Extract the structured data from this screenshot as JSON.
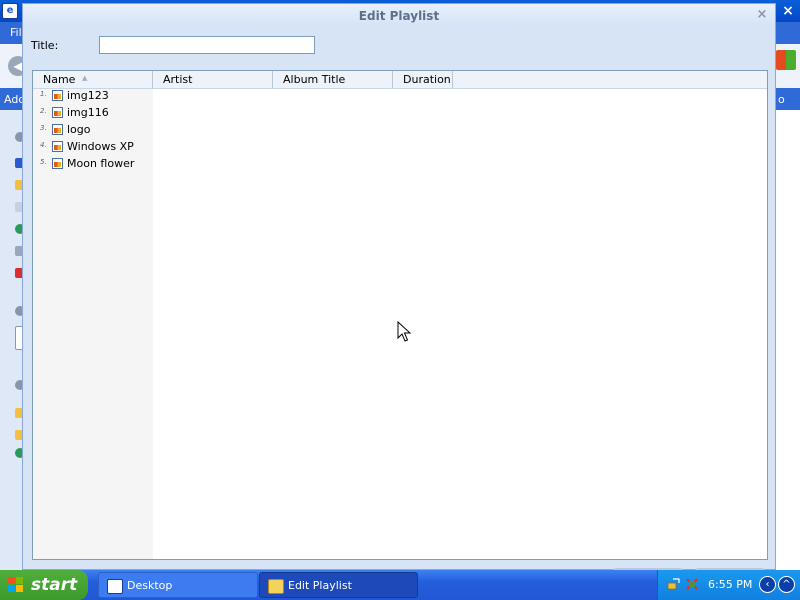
{
  "background_window": {
    "menu_first_item": "Fil",
    "address_label": "Add",
    "address_right_fragment": "o",
    "close_glyph": "×"
  },
  "dialog": {
    "title": "Edit Playlist",
    "close_glyph": "×",
    "title_field": {
      "label": "Title:",
      "value": "",
      "placeholder": ""
    },
    "columns": [
      "Name",
      "Artist",
      "Album Title",
      "Duration"
    ],
    "sort_indicator": "▲",
    "rows": [
      {
        "num": "1.",
        "name": "img123"
      },
      {
        "num": "2.",
        "name": "img116"
      },
      {
        "num": "3.",
        "name": "logo"
      },
      {
        "num": "4.",
        "name": "Windows XP"
      },
      {
        "num": "5.",
        "name": "Moon flower"
      }
    ]
  },
  "taskbar": {
    "start_label": "start",
    "tasks": [
      {
        "label": "Desktop"
      },
      {
        "label": "Edit Playlist"
      }
    ],
    "clock": "6:55 PM"
  },
  "colors": {
    "taskbar_blue": "#245edb",
    "start_green": "#3c9a2b",
    "dialog_bg": "#d6e4f6"
  }
}
